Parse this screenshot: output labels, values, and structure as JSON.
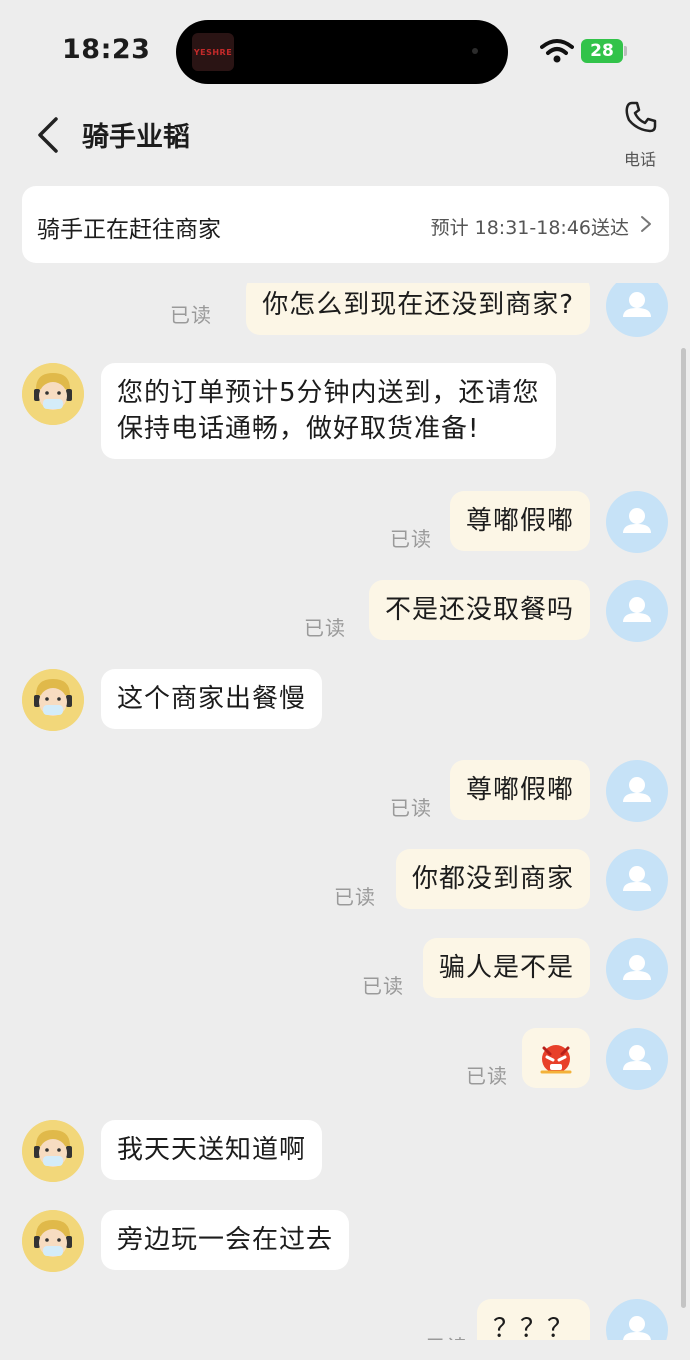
{
  "status_bar": {
    "time": "18:23",
    "battery": "28",
    "island_thumb_text": "YESHRE"
  },
  "nav": {
    "title": "骑手业韬",
    "call_label": "电话",
    "back_icon": "chevron-left-icon",
    "call_icon": "phone-icon"
  },
  "order": {
    "status": "骑手正在赶往商家",
    "eta": "预计 18:31-18:46送达"
  },
  "read_label": "已读",
  "messages": [
    {
      "from": "user",
      "text": "你怎么到现在还没到商家?",
      "read": "已读"
    },
    {
      "from": "rider",
      "lines": [
        "您的订单预计5分钟内送到，还请您",
        "保持电话通畅，做好取货准备!"
      ]
    },
    {
      "from": "user",
      "text": "尊嘟假嘟",
      "read": "已读"
    },
    {
      "from": "user",
      "text": "不是还没取餐吗",
      "read": "已读"
    },
    {
      "from": "rider",
      "text": "这个商家出餐慢"
    },
    {
      "from": "user",
      "text": "尊嘟假嘟",
      "read": "已读"
    },
    {
      "from": "user",
      "text": "你都没到商家",
      "read": "已读"
    },
    {
      "from": "user",
      "text": "骗人是不是",
      "read": "已读"
    },
    {
      "from": "user",
      "emoji": "angry-face-icon",
      "read": "已读"
    },
    {
      "from": "rider",
      "text": "我天天送知道啊"
    },
    {
      "from": "rider",
      "text": "旁边玩一会在过去"
    },
    {
      "from": "user",
      "text": "？？？",
      "read": "已读"
    }
  ],
  "colors": {
    "user_bubble": "#fcf6e6",
    "rider_bubble": "#ffffff",
    "background": "#ededed",
    "user_avatar": "#c6e2f7",
    "rider_avatar": "#f2d77a",
    "battery": "#32c34a"
  }
}
